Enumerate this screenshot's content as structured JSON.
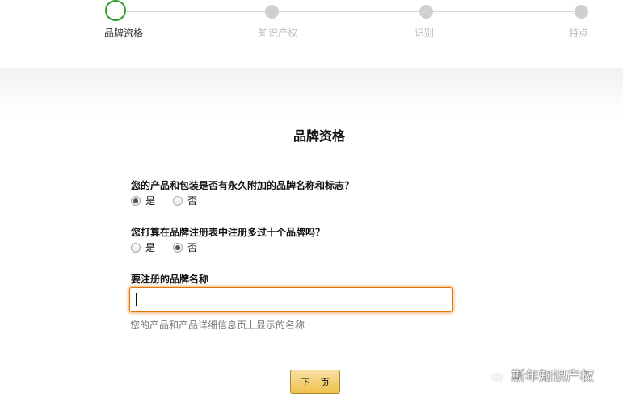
{
  "stepper": {
    "steps": [
      {
        "label": "品牌资格",
        "active": true
      },
      {
        "label": "知识产权",
        "active": false
      },
      {
        "label": "识别",
        "active": false
      },
      {
        "label": "特点",
        "active": false
      }
    ],
    "active_color": "#2f9e2f",
    "inactive_color": "#cfcfcf"
  },
  "form": {
    "title": "品牌资格",
    "questions": [
      {
        "text": "您的产品和包装是否有永久附加的品牌名称和标志？",
        "options": [
          "是",
          "否"
        ],
        "selected": "是"
      },
      {
        "text": "您打算在品牌注册表中注册多过十个品牌吗？",
        "options": [
          "是",
          "否"
        ],
        "selected": "否"
      }
    ],
    "brand_name": {
      "label": "要注册的品牌名称",
      "value": "",
      "hint": "您的产品和产品详细信息页上显示的名称"
    },
    "next_label": "下一页"
  },
  "watermark": {
    "icon": "wechat-icon",
    "text": "斯年知识产权"
  },
  "colors": {
    "input_focus": "#e77600",
    "button_top": "#f7dfa5",
    "button_bottom": "#f0c14b"
  }
}
